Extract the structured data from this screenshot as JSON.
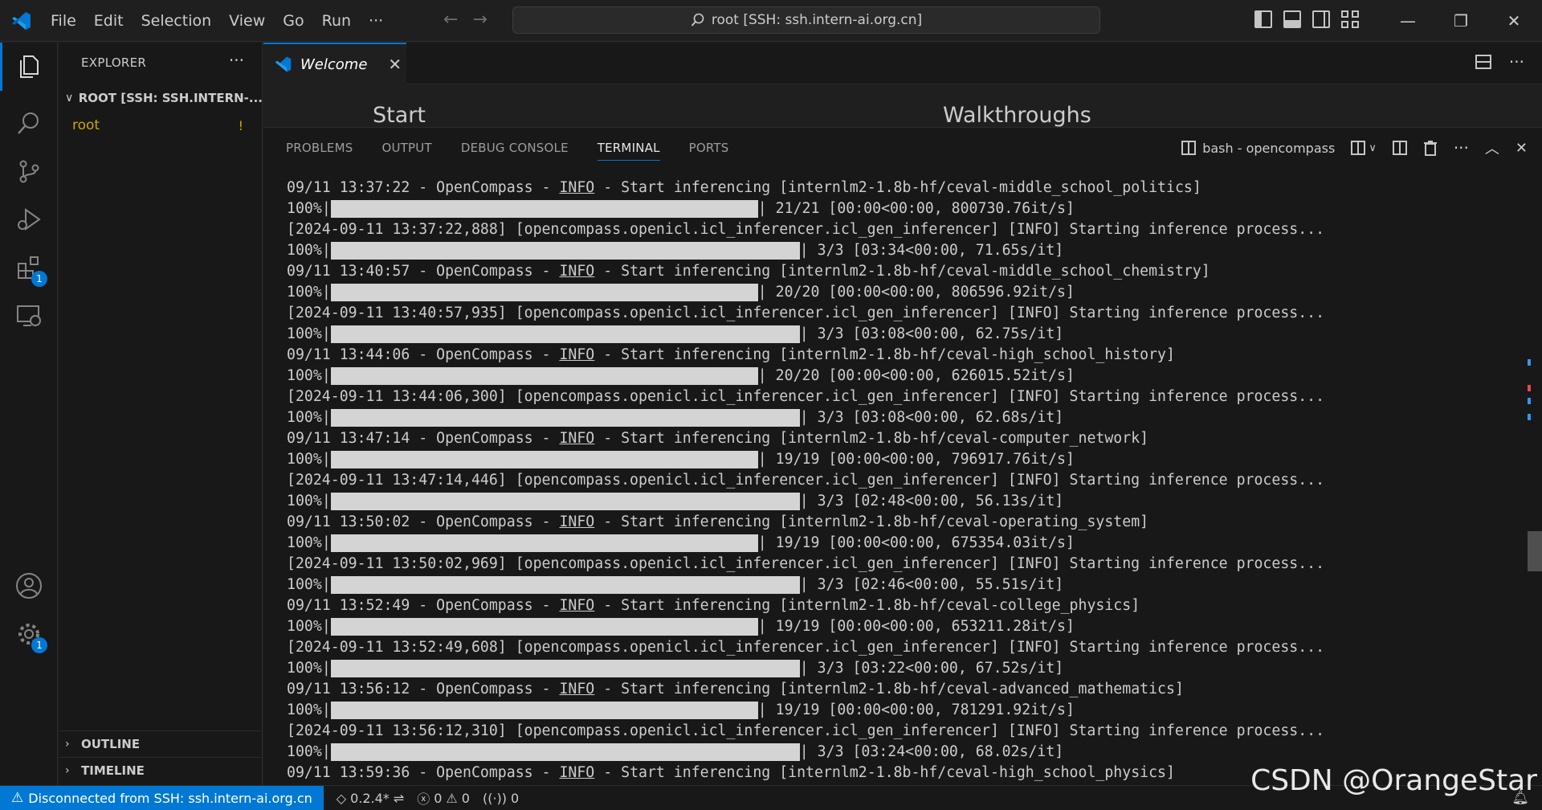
{
  "titlebar": {
    "menu": [
      "File",
      "Edit",
      "Selection",
      "View",
      "Go",
      "Run",
      "···"
    ],
    "search_text": "root [SSH: ssh.intern-ai.org.cn]"
  },
  "activitybar": {
    "items": [
      {
        "name": "explorer",
        "active": true
      },
      {
        "name": "search"
      },
      {
        "name": "source-control"
      },
      {
        "name": "run-debug"
      },
      {
        "name": "extensions",
        "badge": "1"
      },
      {
        "name": "remote-explorer"
      }
    ],
    "bottom": [
      {
        "name": "accounts"
      },
      {
        "name": "manage",
        "badge": "1"
      }
    ]
  },
  "sidebar": {
    "title": "EXPLORER",
    "more": "···",
    "root_label": "ROOT [SSH: SSH.INTERN-...",
    "folder": {
      "name": "root",
      "indicator": "!"
    },
    "outline": "OUTLINE",
    "timeline": "TIMELINE"
  },
  "editor": {
    "tab_label": "Welcome",
    "welcome_start": "Start",
    "welcome_walkthroughs": "Walkthroughs"
  },
  "panel": {
    "tabs": [
      "PROBLEMS",
      "OUTPUT",
      "DEBUG CONSOLE",
      "TERMINAL",
      "PORTS"
    ],
    "active_tab": "TERMINAL",
    "terminal_name": "bash - opencompass"
  },
  "terminal_lines": [
    {
      "type": "log",
      "pre": "09/11 13:37:22 - OpenCompass - ",
      "level": "INFO",
      "post": " - Start inferencing [internlm2-1.8b-hf/ceval-middle_school_politics]"
    },
    {
      "type": "bar",
      "pct": "100%",
      "size": "long",
      "progress": 1.0,
      "tail": "| 21/21 [00:00<00:00, 800730.76it/s]"
    },
    {
      "type": "text",
      "text": "[2024-09-11 13:37:22,888] [opencompass.openicl.icl_inferencer.icl_gen_inferencer] [INFO] Starting inference process..."
    },
    {
      "type": "bar",
      "pct": "100%",
      "size": "xlong",
      "progress": 1.0,
      "tail": "| 3/3 [03:34<00:00, 71.65s/it]"
    },
    {
      "type": "log",
      "pre": "09/11 13:40:57 - OpenCompass - ",
      "level": "INFO",
      "post": " - Start inferencing [internlm2-1.8b-hf/ceval-middle_school_chemistry]"
    },
    {
      "type": "bar",
      "pct": "100%",
      "size": "long",
      "progress": 1.0,
      "tail": "| 20/20 [00:00<00:00, 806596.92it/s]"
    },
    {
      "type": "text",
      "text": "[2024-09-11 13:40:57,935] [opencompass.openicl.icl_inferencer.icl_gen_inferencer] [INFO] Starting inference process..."
    },
    {
      "type": "bar",
      "pct": "100%",
      "size": "xlong",
      "progress": 1.0,
      "tail": "| 3/3 [03:08<00:00, 62.75s/it]"
    },
    {
      "type": "log",
      "pre": "09/11 13:44:06 - OpenCompass - ",
      "level": "INFO",
      "post": " - Start inferencing [internlm2-1.8b-hf/ceval-high_school_history]"
    },
    {
      "type": "bar",
      "pct": "100%",
      "size": "long",
      "progress": 1.0,
      "tail": "| 20/20 [00:00<00:00, 626015.52it/s]"
    },
    {
      "type": "text",
      "text": "[2024-09-11 13:44:06,300] [opencompass.openicl.icl_inferencer.icl_gen_inferencer] [INFO] Starting inference process..."
    },
    {
      "type": "bar",
      "pct": "100%",
      "size": "xlong",
      "progress": 1.0,
      "tail": "| 3/3 [03:08<00:00, 62.68s/it]"
    },
    {
      "type": "log",
      "pre": "09/11 13:47:14 - OpenCompass - ",
      "level": "INFO",
      "post": " - Start inferencing [internlm2-1.8b-hf/ceval-computer_network]"
    },
    {
      "type": "bar",
      "pct": "100%",
      "size": "long",
      "progress": 1.0,
      "tail": "| 19/19 [00:00<00:00, 796917.76it/s]"
    },
    {
      "type": "text",
      "text": "[2024-09-11 13:47:14,446] [opencompass.openicl.icl_inferencer.icl_gen_inferencer] [INFO] Starting inference process..."
    },
    {
      "type": "bar",
      "pct": "100%",
      "size": "xlong",
      "progress": 1.0,
      "tail": "| 3/3 [02:48<00:00, 56.13s/it]"
    },
    {
      "type": "log",
      "pre": "09/11 13:50:02 - OpenCompass - ",
      "level": "INFO",
      "post": " - Start inferencing [internlm2-1.8b-hf/ceval-operating_system]"
    },
    {
      "type": "bar",
      "pct": "100%",
      "size": "long",
      "progress": 1.0,
      "tail": "| 19/19 [00:00<00:00, 675354.03it/s]"
    },
    {
      "type": "text",
      "text": "[2024-09-11 13:50:02,969] [opencompass.openicl.icl_inferencer.icl_gen_inferencer] [INFO] Starting inference process..."
    },
    {
      "type": "bar",
      "pct": "100%",
      "size": "xlong",
      "progress": 1.0,
      "tail": "| 3/3 [02:46<00:00, 55.51s/it]"
    },
    {
      "type": "log",
      "pre": "09/11 13:52:49 - OpenCompass - ",
      "level": "INFO",
      "post": " - Start inferencing [internlm2-1.8b-hf/ceval-college_physics]"
    },
    {
      "type": "bar",
      "pct": "100%",
      "size": "long",
      "progress": 1.0,
      "tail": "| 19/19 [00:00<00:00, 653211.28it/s]"
    },
    {
      "type": "text",
      "text": "[2024-09-11 13:52:49,608] [opencompass.openicl.icl_inferencer.icl_gen_inferencer] [INFO] Starting inference process..."
    },
    {
      "type": "bar",
      "pct": "100%",
      "size": "xlong",
      "progress": 1.0,
      "tail": "| 3/3 [03:22<00:00, 67.52s/it]"
    },
    {
      "type": "log",
      "pre": "09/11 13:56:12 - OpenCompass - ",
      "level": "INFO",
      "post": " - Start inferencing [internlm2-1.8b-hf/ceval-advanced_mathematics]"
    },
    {
      "type": "bar",
      "pct": "100%",
      "size": "long",
      "progress": 1.0,
      "tail": "| 19/19 [00:00<00:00, 781291.92it/s]"
    },
    {
      "type": "text",
      "text": "[2024-09-11 13:56:12,310] [opencompass.openicl.icl_inferencer.icl_gen_inferencer] [INFO] Starting inference process..."
    },
    {
      "type": "bar",
      "pct": "100%",
      "size": "xlong",
      "progress": 1.0,
      "tail": "| 3/3 [03:24<00:00, 68.02s/it]"
    },
    {
      "type": "log",
      "pre": "09/11 13:59:36 - OpenCompass - ",
      "level": "INFO",
      "post": " - Start inferencing [internlm2-1.8b-hf/ceval-high_school_physics]"
    }
  ],
  "statusbar": {
    "remote": "Disconnected from SSH: ssh.intern-ai.org.cn",
    "version": "0.2.4*",
    "errors": "0",
    "warnings": "0",
    "ports": "0"
  },
  "watermark": "CSDN @OrangeStar",
  "colors": {
    "accent": "#0078d4",
    "folder_warning": "#cca700",
    "background": "#1f1f1f",
    "panel": "#181818"
  }
}
